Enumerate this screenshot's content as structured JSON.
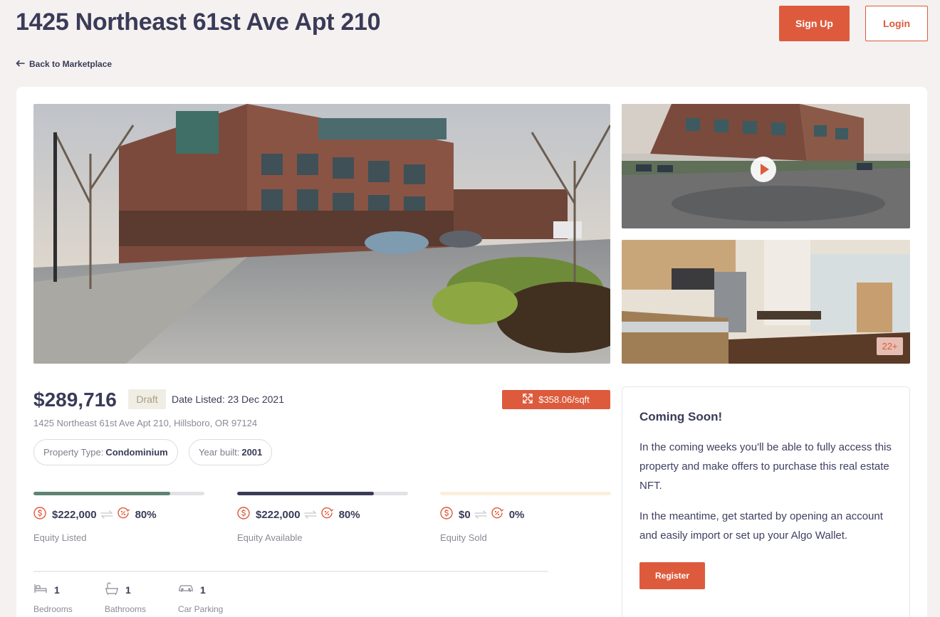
{
  "header": {
    "title": "1425 Northeast 61st Ave Apt 210",
    "signup_label": "Sign Up",
    "login_label": "Login",
    "back_label": "Back to Marketplace"
  },
  "gallery": {
    "more_photos": "22+"
  },
  "listing": {
    "price": "$289,716",
    "status": "Draft",
    "date_listed": "Date Listed: 23 Dec 2021",
    "price_per_sqft": "$358.06/sqft",
    "address": "1425 Northeast 61st Ave Apt 210, Hillsboro, OR 97124",
    "property_type_label": "Property Type:",
    "property_type_value": "Condominium",
    "year_built_label": "Year built:",
    "year_built_value": "2001"
  },
  "equity": [
    {
      "amount": "$222,000",
      "percent": "80%",
      "label": "Equity Listed",
      "progress": 0.8,
      "color": "#5e8373"
    },
    {
      "amount": "$222,000",
      "percent": "80%",
      "label": "Equity Available",
      "progress": 0.8,
      "color": "#3a3b58"
    },
    {
      "amount": "$0",
      "percent": "0%",
      "label": "Equity Sold",
      "progress": 0,
      "color": "#f3c98e"
    }
  ],
  "features": [
    {
      "value": "1",
      "label": "Bedrooms",
      "icon": "bed-icon"
    },
    {
      "value": "1",
      "label": "Bathrooms",
      "icon": "bathtub-icon"
    },
    {
      "value": "1",
      "label": "Car Parking",
      "icon": "car-icon"
    }
  ],
  "promo": {
    "title": "Coming Soon!",
    "paragraph1": "In the coming weeks you'll be able to fully access this property and make offers to purchase this real estate NFT.",
    "paragraph2": "In the meantime, get started by opening an account and easily import or set up your Algo Wallet.",
    "register_label": "Register"
  },
  "colors": {
    "accent": "#dd5b3c",
    "text": "#3a3b58",
    "background": "#f4f1f0"
  }
}
